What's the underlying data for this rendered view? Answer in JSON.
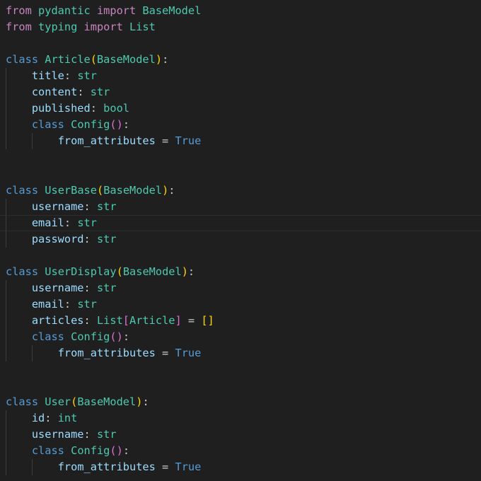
{
  "editor": {
    "background": "#1f1f1f",
    "colors": {
      "import_keyword": "#c586c0",
      "keyword": "#569cd6",
      "class_name": "#4ec9b0",
      "attribute": "#9cdcfe",
      "bracket_level1": "#ffd700",
      "bracket_level2": "#da70d6",
      "text": "#cccccc"
    },
    "cursor_line": 13,
    "lines": [
      [
        [
          "from",
          "kw-import"
        ],
        [
          " pydantic ",
          "cls"
        ],
        [
          "import",
          "kw-import"
        ],
        [
          " BaseModel",
          "cls"
        ]
      ],
      [
        [
          "from",
          "kw-import"
        ],
        [
          " typing ",
          "cls"
        ],
        [
          "import",
          "kw-import"
        ],
        [
          " List",
          "cls"
        ]
      ],
      [],
      [
        [
          "class",
          "kw"
        ],
        [
          " ",
          "plain"
        ],
        [
          "Article",
          "cls"
        ],
        [
          "(",
          "b1"
        ],
        [
          "BaseModel",
          "cls"
        ],
        [
          ")",
          "b1"
        ],
        [
          ":",
          "punc"
        ]
      ],
      [
        [
          "    ",
          "plain"
        ],
        [
          "title",
          "attr"
        ],
        [
          ": ",
          "punc"
        ],
        [
          "str",
          "builtin"
        ]
      ],
      [
        [
          "    ",
          "plain"
        ],
        [
          "content",
          "attr"
        ],
        [
          ": ",
          "punc"
        ],
        [
          "str",
          "builtin"
        ]
      ],
      [
        [
          "    ",
          "plain"
        ],
        [
          "published",
          "attr"
        ],
        [
          ": ",
          "punc"
        ],
        [
          "bool",
          "builtin"
        ]
      ],
      [
        [
          "    ",
          "plain"
        ],
        [
          "class",
          "kw"
        ],
        [
          " ",
          "plain"
        ],
        [
          "Config",
          "cls"
        ],
        [
          "(",
          "b2"
        ],
        [
          ")",
          "b2"
        ],
        [
          ":",
          "punc"
        ]
      ],
      [
        [
          "        ",
          "plain"
        ],
        [
          "from_attributes",
          "attr"
        ],
        [
          " = ",
          "punc"
        ],
        [
          "True",
          "const"
        ]
      ],
      [],
      [],
      [
        [
          "class",
          "kw"
        ],
        [
          " ",
          "plain"
        ],
        [
          "UserBase",
          "cls"
        ],
        [
          "(",
          "b1"
        ],
        [
          "BaseModel",
          "cls"
        ],
        [
          ")",
          "b1"
        ],
        [
          ":",
          "punc"
        ]
      ],
      [
        [
          "    ",
          "plain"
        ],
        [
          "username",
          "attr"
        ],
        [
          ": ",
          "punc"
        ],
        [
          "str",
          "builtin"
        ]
      ],
      [
        [
          "    ",
          "plain"
        ],
        [
          "email",
          "attr"
        ],
        [
          ": ",
          "punc"
        ],
        [
          "str",
          "builtin"
        ]
      ],
      [
        [
          "    ",
          "plain"
        ],
        [
          "password",
          "attr"
        ],
        [
          ": ",
          "punc"
        ],
        [
          "str",
          "builtin"
        ]
      ],
      [],
      [
        [
          "class",
          "kw"
        ],
        [
          " ",
          "plain"
        ],
        [
          "UserDisplay",
          "cls"
        ],
        [
          "(",
          "b1"
        ],
        [
          "BaseModel",
          "cls"
        ],
        [
          ")",
          "b1"
        ],
        [
          ":",
          "punc"
        ]
      ],
      [
        [
          "    ",
          "plain"
        ],
        [
          "username",
          "attr"
        ],
        [
          ": ",
          "punc"
        ],
        [
          "str",
          "builtin"
        ]
      ],
      [
        [
          "    ",
          "plain"
        ],
        [
          "email",
          "attr"
        ],
        [
          ": ",
          "punc"
        ],
        [
          "str",
          "builtin"
        ]
      ],
      [
        [
          "    ",
          "plain"
        ],
        [
          "articles",
          "attr"
        ],
        [
          ": ",
          "punc"
        ],
        [
          "List",
          "cls"
        ],
        [
          "[",
          "b2"
        ],
        [
          "Article",
          "cls"
        ],
        [
          "]",
          "b2"
        ],
        [
          " = ",
          "punc"
        ],
        [
          "[]",
          "b1"
        ]
      ],
      [
        [
          "    ",
          "plain"
        ],
        [
          "class",
          "kw"
        ],
        [
          " ",
          "plain"
        ],
        [
          "Config",
          "cls"
        ],
        [
          "(",
          "b2"
        ],
        [
          ")",
          "b2"
        ],
        [
          ":",
          "punc"
        ]
      ],
      [
        [
          "        ",
          "plain"
        ],
        [
          "from_attributes",
          "attr"
        ],
        [
          " = ",
          "punc"
        ],
        [
          "True",
          "const"
        ]
      ],
      [],
      [],
      [
        [
          "class",
          "kw"
        ],
        [
          " ",
          "plain"
        ],
        [
          "User",
          "cls"
        ],
        [
          "(",
          "b1"
        ],
        [
          "BaseModel",
          "cls"
        ],
        [
          ")",
          "b1"
        ],
        [
          ":",
          "punc"
        ]
      ],
      [
        [
          "    ",
          "plain"
        ],
        [
          "id",
          "attr"
        ],
        [
          ": ",
          "punc"
        ],
        [
          "int",
          "builtin"
        ]
      ],
      [
        [
          "    ",
          "plain"
        ],
        [
          "username",
          "attr"
        ],
        [
          ": ",
          "punc"
        ],
        [
          "str",
          "builtin"
        ]
      ],
      [
        [
          "    ",
          "plain"
        ],
        [
          "class",
          "kw"
        ],
        [
          " ",
          "plain"
        ],
        [
          "Config",
          "cls"
        ],
        [
          "(",
          "b2"
        ],
        [
          ")",
          "b2"
        ],
        [
          ":",
          "punc"
        ]
      ],
      [
        [
          "        ",
          "plain"
        ],
        [
          "from_attributes",
          "attr"
        ],
        [
          " = ",
          "punc"
        ],
        [
          "True",
          "const"
        ]
      ]
    ]
  }
}
